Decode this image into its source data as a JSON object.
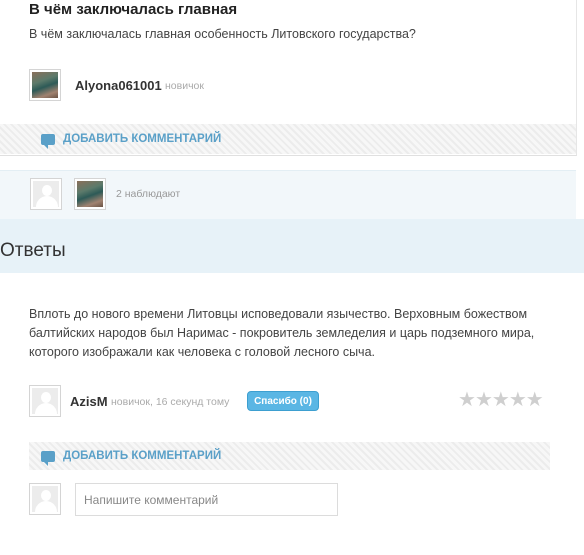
{
  "question": {
    "title": "В чём заключалась главная",
    "text": "В чём заключалась главная особенность Литовского государства?",
    "author": {
      "name": "Alyona061001",
      "rank": "новичок"
    },
    "add_comment_label": "ДОБАВИТЬ КОММЕНТАРИЙ"
  },
  "watchers": {
    "text": "2 наблюдают"
  },
  "answers": {
    "heading": "Ответы",
    "items": [
      {
        "text": "Вплоть до нового времени Литовцы исповедовали язычество. Верховным божеством балтийских народов был Наримас - покровитель земледелия и царь подземного мира, которого изображали как человека с головой  лесного сыча.",
        "author": {
          "name": "AzisM",
          "meta": "новичок, 16 секунд тому"
        },
        "thanks_label": "Спасибо (0)",
        "rating": {
          "value": 0,
          "max": 5
        },
        "add_comment_label": "ДОБАВИТЬ КОММЕНТАРИЙ",
        "comment_placeholder": "Напишите комментарий"
      }
    ]
  },
  "colors": {
    "accent": "#5aa0c8",
    "thanks_button": "#5ab6e4",
    "answers_bar": "#e7f2f8"
  }
}
